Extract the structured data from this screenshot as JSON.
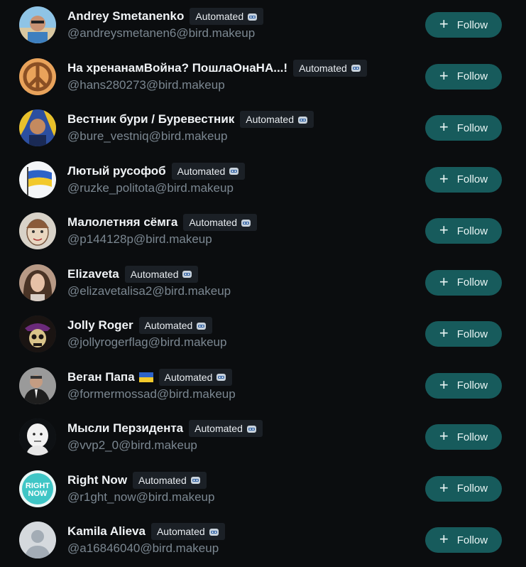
{
  "badge_label": "Automated",
  "follow_label": "Follow",
  "users": [
    {
      "name": "Andrey Smetanenko",
      "handle": "@andreysmetanen6@bird.makeup",
      "avatar": "beach-portrait"
    },
    {
      "name": "На хренанамВойна? ПошлаОнаНА...!",
      "handle": "@hans280273@bird.makeup",
      "avatar": "peace-sign"
    },
    {
      "name": "Вестник бури / Буревестник",
      "handle": "@bure_vestniq@bird.makeup",
      "avatar": "painted-portrait"
    },
    {
      "name": "Лютый русофоб",
      "handle": "@ruzke_politota@bird.makeup",
      "avatar": "ukraine-flag"
    },
    {
      "name": "Малолетняя сёмга",
      "handle": "@p144128p@bird.makeup",
      "avatar": "drawn-face"
    },
    {
      "name": "Elizaveta",
      "handle": "@elizavetalisa2@bird.makeup",
      "avatar": "woman-portrait"
    },
    {
      "name": "Jolly Roger",
      "handle": "@jollyrogerflag@bird.makeup",
      "avatar": "pirate-skull"
    },
    {
      "name": "Веган Папа",
      "handle": "@formermossad@bird.makeup",
      "avatar": "man-in-suit",
      "flag": "ukraine"
    },
    {
      "name": "Мысли Перзидента",
      "handle": "@vvp2_0@bird.makeup",
      "avatar": "cartoon-head"
    },
    {
      "name": "Right Now",
      "handle": "@r1ght_now@bird.makeup",
      "avatar": "right-now-logo",
      "logo_text": [
        "RIGHT",
        "NOW"
      ]
    },
    {
      "name": "Kamila Alieva",
      "handle": "@a16846040@bird.makeup",
      "avatar": "default-user"
    }
  ],
  "colors": {
    "background": "#0b0d0f",
    "follow_button": "#175b5c",
    "badge_bg": "#1b2026",
    "handle_text": "#7b8791"
  }
}
